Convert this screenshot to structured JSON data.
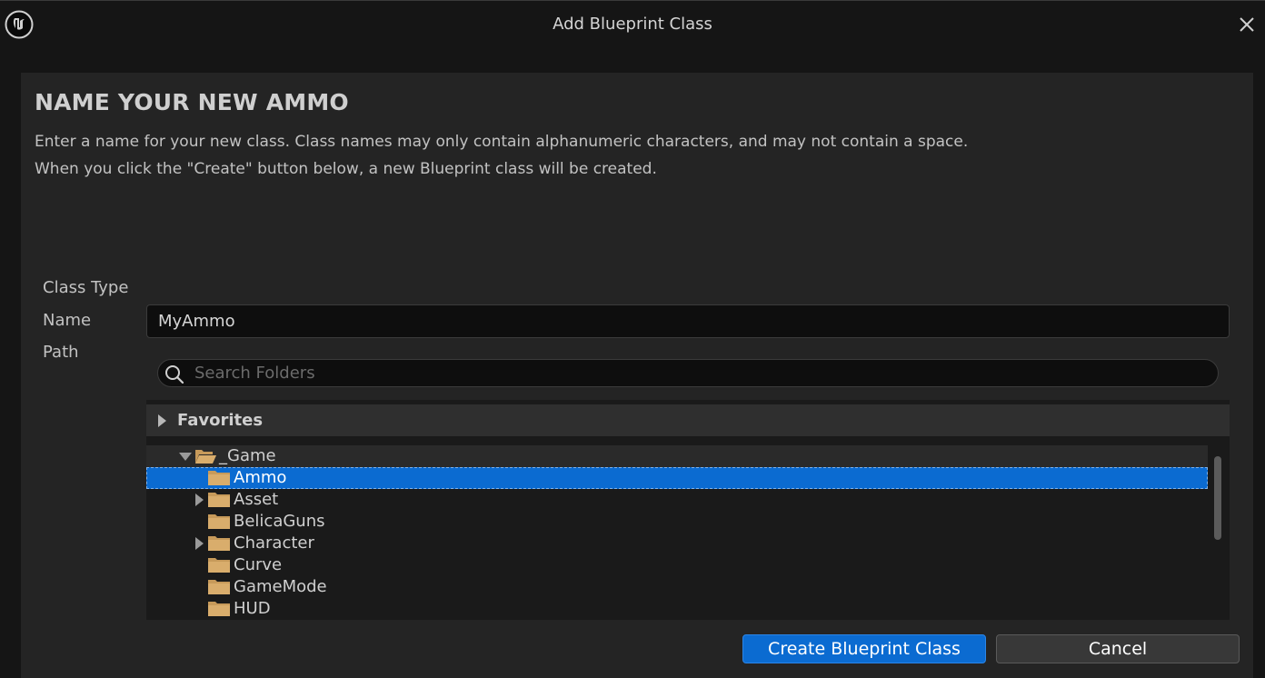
{
  "window": {
    "title": "Add Blueprint Class"
  },
  "dialog": {
    "heading": "NAME YOUR NEW AMMO",
    "description_line1": "Enter a name for your new class. Class names may only contain alphanumeric characters, and may not contain a space.",
    "description_line2": "When you click the \"Create\" button below, a new Blueprint class will be created."
  },
  "form": {
    "class_type_label": "Class Type",
    "name_label": "Name",
    "path_label": "Path",
    "name_value": "MyAmmo"
  },
  "search": {
    "placeholder": "Search Folders",
    "value": ""
  },
  "tree": {
    "favorites_label": "Favorites",
    "root": {
      "label": "_Game",
      "expanded": true
    },
    "items": [
      {
        "label": "Ammo",
        "selected": true,
        "has_children": false
      },
      {
        "label": "Asset",
        "selected": false,
        "has_children": true
      },
      {
        "label": "BelicaGuns",
        "selected": false,
        "has_children": false
      },
      {
        "label": "Character",
        "selected": false,
        "has_children": true
      },
      {
        "label": "Curve",
        "selected": false,
        "has_children": false
      },
      {
        "label": "GameMode",
        "selected": false,
        "has_children": false
      },
      {
        "label": "HUD",
        "selected": false,
        "has_children": false
      }
    ]
  },
  "buttons": {
    "create_label": "Create Blueprint Class",
    "cancel_label": "Cancel"
  },
  "colors": {
    "accent": "#0b6bd1",
    "folder": "#c79a5a",
    "background": "#151515",
    "panel": "#242424"
  },
  "icons": {
    "logo": "unreal-engine-logo-icon",
    "close": "close-icon",
    "search": "search-icon",
    "folder": "folder-icon",
    "folder_open": "folder-open-icon"
  }
}
